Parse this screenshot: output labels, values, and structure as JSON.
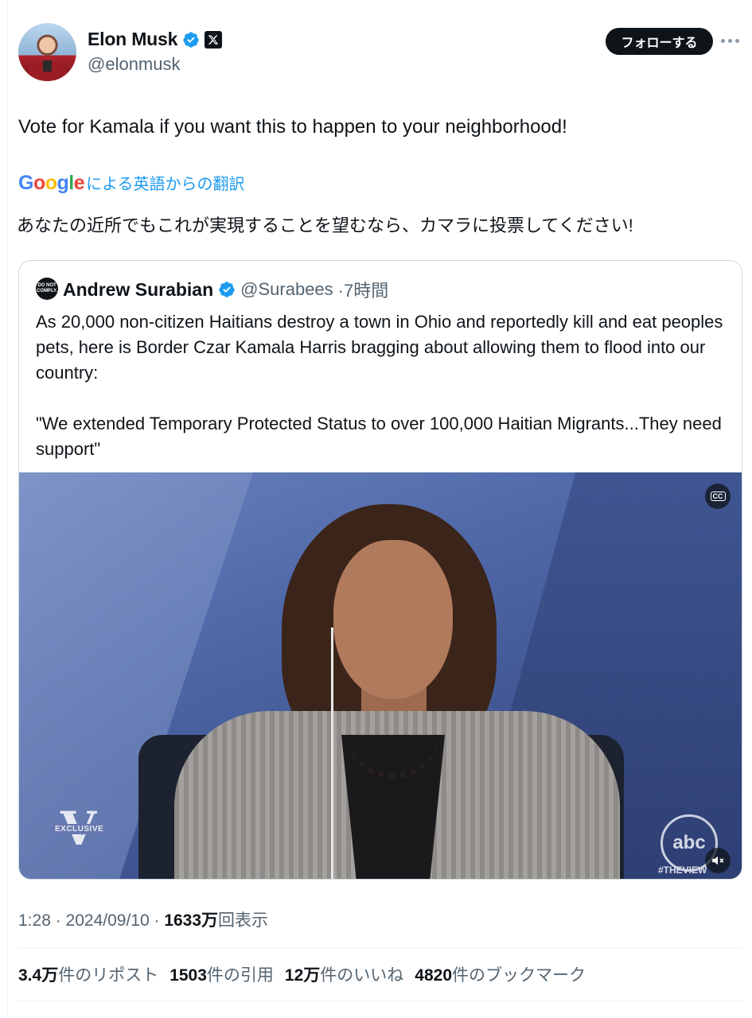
{
  "author": {
    "name": "Elon Musk",
    "handle": "@elonmusk"
  },
  "actions": {
    "follow_label": "フォローする"
  },
  "tweet": {
    "text": "Vote for Kamala if you want this to happen to your neighborhood!",
    "translation_provider": "Google",
    "translation_label": "による英語からの翻訳",
    "translated_text": "あなたの近所でもこれが実現することを望むなら、カマラに投票してください!"
  },
  "quote": {
    "avatar_text": "DO NOT COMPLY.",
    "name": "Andrew Surabian",
    "handle": "@Surabees",
    "time": "·7時間",
    "paragraph1": "As 20,000 non-citizen Haitians destroy a town in Ohio and reportedly kill and eat peoples pets, here is Border Czar Kamala Harris bragging about allowing them to flood into our country:",
    "paragraph2": "\"We extended Temporary Protected Status to over 100,000 Haitian Migrants...They need support\"",
    "video": {
      "watermark_letter": "V",
      "watermark_tag": "EXCLUSIVE",
      "network_logo": "abc",
      "network_tag": "#THEVIEW",
      "cc_label": "CC"
    }
  },
  "meta": {
    "time": "1:28",
    "date": "2024/09/10",
    "views_value": "1633万",
    "views_label": "回表示"
  },
  "stats": {
    "reposts_value": "3.4万",
    "reposts_label": "件のリポスト",
    "quotes_value": "1503",
    "quotes_label": "件の引用",
    "likes_value": "12万",
    "likes_label": "件のいいね",
    "bookmarks_value": "4820",
    "bookmarks_label": "件のブックマーク"
  },
  "colors": {
    "accent": "#1d9bf0",
    "text": "#0f1419",
    "secondary": "#536471"
  }
}
